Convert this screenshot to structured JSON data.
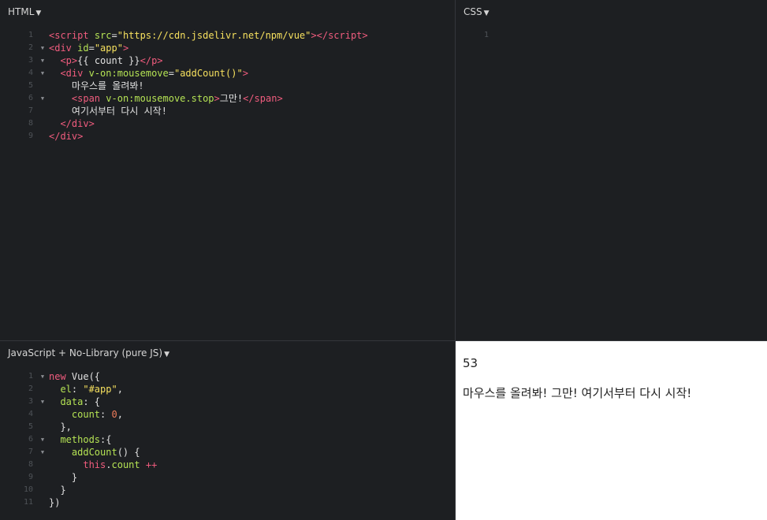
{
  "panes": {
    "html": {
      "title": "HTML",
      "lines": [
        {
          "n": "1",
          "fold": "",
          "tokens": [
            [
              "tag",
              "<script"
            ],
            [
              "txt",
              " "
            ],
            [
              "attr",
              "src"
            ],
            [
              "txt",
              "="
            ],
            [
              "str",
              "\"https://cdn.jsdelivr.net/npm/vue\""
            ],
            [
              "tag",
              "></"
            ],
            [
              "tag",
              "script"
            ],
            [
              "tag",
              ">"
            ]
          ]
        },
        {
          "n": "2",
          "fold": "▼",
          "tokens": [
            [
              "tag",
              "<div"
            ],
            [
              "txt",
              " "
            ],
            [
              "attr",
              "id"
            ],
            [
              "txt",
              "="
            ],
            [
              "str",
              "\"app\""
            ],
            [
              "tag",
              ">"
            ]
          ]
        },
        {
          "n": "3",
          "fold": "▼",
          "tokens": [
            [
              "txt",
              "  "
            ],
            [
              "tag",
              "<p>"
            ],
            [
              "txt",
              "{{ count }}"
            ],
            [
              "tag",
              "</p>"
            ]
          ]
        },
        {
          "n": "4",
          "fold": "▼",
          "tokens": [
            [
              "txt",
              "  "
            ],
            [
              "tag",
              "<div"
            ],
            [
              "txt",
              " "
            ],
            [
              "attr",
              "v-on:mousemove"
            ],
            [
              "txt",
              "="
            ],
            [
              "str",
              "\"addCount()\""
            ],
            [
              "tag",
              ">"
            ]
          ]
        },
        {
          "n": "5",
          "fold": "",
          "tokens": [
            [
              "txt",
              "    마우스를 올려봐!"
            ]
          ]
        },
        {
          "n": "6",
          "fold": "▼",
          "tokens": [
            [
              "txt",
              "    "
            ],
            [
              "tag",
              "<span"
            ],
            [
              "txt",
              " "
            ],
            [
              "attr",
              "v-on:mousemove.stop"
            ],
            [
              "tag",
              ">"
            ],
            [
              "txt",
              "그만!"
            ],
            [
              "tag",
              "</span>"
            ]
          ]
        },
        {
          "n": "7",
          "fold": "",
          "tokens": [
            [
              "txt",
              "    여기서부터 다시 시작!"
            ]
          ]
        },
        {
          "n": "8",
          "fold": "",
          "tokens": [
            [
              "txt",
              "  "
            ],
            [
              "tag",
              "</div>"
            ]
          ]
        },
        {
          "n": "9",
          "fold": "",
          "tokens": [
            [
              "tag",
              "</div>"
            ]
          ]
        }
      ]
    },
    "css": {
      "title": "CSS",
      "lines": [
        {
          "n": "1",
          "fold": "",
          "tokens": []
        }
      ]
    },
    "js": {
      "title": "JavaScript + No-Library (pure JS)",
      "lines": [
        {
          "n": "1",
          "fold": "▼",
          "tokens": [
            [
              "kw",
              "new"
            ],
            [
              "txt",
              " Vue({"
            ]
          ]
        },
        {
          "n": "2",
          "fold": "",
          "tokens": [
            [
              "txt",
              "  "
            ],
            [
              "prop",
              "el"
            ],
            [
              "txt",
              ": "
            ],
            [
              "str",
              "\"#app\""
            ],
            [
              "txt",
              ","
            ]
          ]
        },
        {
          "n": "3",
          "fold": "▼",
          "tokens": [
            [
              "txt",
              "  "
            ],
            [
              "prop",
              "data"
            ],
            [
              "txt",
              ": {"
            ]
          ]
        },
        {
          "n": "4",
          "fold": "",
          "tokens": [
            [
              "txt",
              "    "
            ],
            [
              "prop",
              "count"
            ],
            [
              "txt",
              ": "
            ],
            [
              "num",
              "0"
            ],
            [
              "txt",
              ","
            ]
          ]
        },
        {
          "n": "5",
          "fold": "",
          "tokens": [
            [
              "txt",
              "  },"
            ]
          ]
        },
        {
          "n": "6",
          "fold": "▼",
          "tokens": [
            [
              "txt",
              "  "
            ],
            [
              "prop",
              "methods"
            ],
            [
              "txt",
              ":{"
            ]
          ]
        },
        {
          "n": "7",
          "fold": "▼",
          "tokens": [
            [
              "txt",
              "    "
            ],
            [
              "prop",
              "addCount"
            ],
            [
              "txt",
              "() {"
            ]
          ]
        },
        {
          "n": "8",
          "fold": "",
          "tokens": [
            [
              "txt",
              "      "
            ],
            [
              "kw",
              "this"
            ],
            [
              "txt",
              "."
            ],
            [
              "prop",
              "count"
            ],
            [
              "txt",
              " "
            ],
            [
              "op",
              "++"
            ]
          ]
        },
        {
          "n": "9",
          "fold": "",
          "tokens": [
            [
              "txt",
              "    }"
            ]
          ]
        },
        {
          "n": "10",
          "fold": "",
          "tokens": [
            [
              "txt",
              "  }"
            ]
          ]
        },
        {
          "n": "11",
          "fold": "",
          "tokens": [
            [
              "txt",
              "})"
            ]
          ]
        }
      ]
    }
  },
  "result": {
    "count": "53",
    "text": "마우스를 올려봐! 그만! 여기서부터 다시 시작!"
  }
}
